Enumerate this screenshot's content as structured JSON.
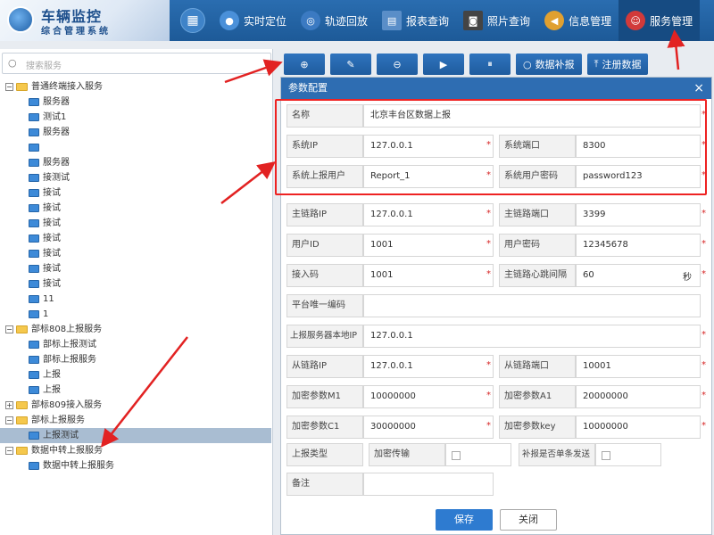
{
  "app": {
    "title": "车辆监控",
    "subtitle": "综合管理系统"
  },
  "nav": [
    {
      "label": "实时定位",
      "icon": "person-location-icon",
      "color": "#4a90d9"
    },
    {
      "label": "轨迹回放",
      "icon": "trajectory-icon",
      "color": "#3b7ac2"
    },
    {
      "label": "报表查询",
      "icon": "report-icon",
      "color": "#5a8ec8"
    },
    {
      "label": "照片查询",
      "icon": "camera-icon",
      "color": "#444"
    },
    {
      "label": "信息管理",
      "icon": "megaphone-icon",
      "color": "#e0a030"
    },
    {
      "label": "服务管理",
      "icon": "service-user-icon",
      "color": "#d23a3a"
    }
  ],
  "sidebar": {
    "search_placeholder": "搜索服务",
    "tree": [
      {
        "label": "普通终端接入服务",
        "level": 0,
        "type": "folder",
        "expanded": true
      },
      {
        "label": "服务器",
        "level": 1,
        "type": "pc"
      },
      {
        "label": "测试1",
        "level": 1,
        "type": "pc"
      },
      {
        "label": "服务器",
        "level": 1,
        "type": "pc"
      },
      {
        "label": "",
        "level": 1,
        "type": "pc"
      },
      {
        "label": "服务器",
        "level": 1,
        "type": "pc"
      },
      {
        "label": "接测试",
        "level": 1,
        "type": "pc"
      },
      {
        "label": "接试",
        "level": 1,
        "type": "pc"
      },
      {
        "label": "接试",
        "level": 1,
        "type": "pc"
      },
      {
        "label": "接试",
        "level": 1,
        "type": "pc"
      },
      {
        "label": "接试",
        "level": 1,
        "type": "pc"
      },
      {
        "label": "接试",
        "level": 1,
        "type": "pc"
      },
      {
        "label": "接试",
        "level": 1,
        "type": "pc"
      },
      {
        "label": "接试",
        "level": 1,
        "type": "pc"
      },
      {
        "label": "11",
        "level": 1,
        "type": "pc"
      },
      {
        "label": "1",
        "level": 1,
        "type": "pc"
      },
      {
        "label": "部标808上报服务",
        "level": 0,
        "type": "folder",
        "expanded": true
      },
      {
        "label": "部标上报测试",
        "level": 1,
        "type": "pc"
      },
      {
        "label": "部标上报服务",
        "level": 1,
        "type": "pc"
      },
      {
        "label": "上报",
        "level": 1,
        "type": "pc"
      },
      {
        "label": "上报",
        "level": 1,
        "type": "pc"
      },
      {
        "label": "部标809接入服务",
        "level": 0,
        "type": "folder",
        "expanded": false
      },
      {
        "label": "部标上报服务",
        "level": 0,
        "type": "folder",
        "expanded": true
      },
      {
        "label": "上报测试",
        "level": 1,
        "type": "pc",
        "selected": true
      },
      {
        "label": "数据中转上报服务",
        "level": 0,
        "type": "folder",
        "expanded": true
      },
      {
        "label": "数据中转上报服务",
        "level": 1,
        "type": "pc"
      }
    ]
  },
  "toolbar": {
    "add_icon": "⊕",
    "edit_icon": "✎",
    "remove_icon": "⊖",
    "start_icon": "▶",
    "pause_icon": "⏸",
    "data_fill_label": "数据补报",
    "register_label": "注册数据"
  },
  "dialog": {
    "title": "参数配置",
    "close": "×",
    "fields": {
      "name_label": "名称",
      "name_value": "北京丰台区数据上报",
      "sys_ip_label": "系统IP",
      "sys_ip_value": "127.0.0.1",
      "sys_port_label": "系统端口",
      "sys_port_value": "8300",
      "sys_user_label": "系统上报用户",
      "sys_user_value": "Report_1",
      "sys_pwd_label": "系统用户密码",
      "sys_pwd_value": "password123",
      "main_ip_label": "主链路IP",
      "main_ip_value": "127.0.0.1",
      "main_port_label": "主链路端口",
      "main_port_value": "3399",
      "user_id_label": "用户ID",
      "user_id_value": "1001",
      "user_pwd_label": "用户密码",
      "user_pwd_value": "12345678",
      "access_code_label": "接入码",
      "access_code_value": "1001",
      "heartbeat_label": "主链路心跳间隔",
      "heartbeat_value": "60",
      "heartbeat_unit": "秒",
      "platform_code_label": "平台唯一编码",
      "platform_code_value": "",
      "local_ip_label": "上报服务器本地IP",
      "local_ip_value": "127.0.0.1",
      "sub_ip_label": "从链路IP",
      "sub_ip_value": "127.0.0.1",
      "sub_port_label": "从链路端口",
      "sub_port_value": "10001",
      "m1_label": "加密参数M1",
      "m1_value": "10000000",
      "a1_label": "加密参数A1",
      "a1_value": "20000000",
      "c1_label": "加密参数C1",
      "c1_value": "30000000",
      "key_label": "加密参数key",
      "key_value": "10000000",
      "report_type_label": "上报类型",
      "encrypt_label": "加密传输",
      "single_label": "补报是否单条发送",
      "remark_label": "备注",
      "remark_value": ""
    },
    "save_label": "保存",
    "close_label": "关闭",
    "required_mark": "*"
  },
  "colors": {
    "header": "#1d5a98",
    "accent": "#2e6db2",
    "annotation": "#e22222"
  }
}
